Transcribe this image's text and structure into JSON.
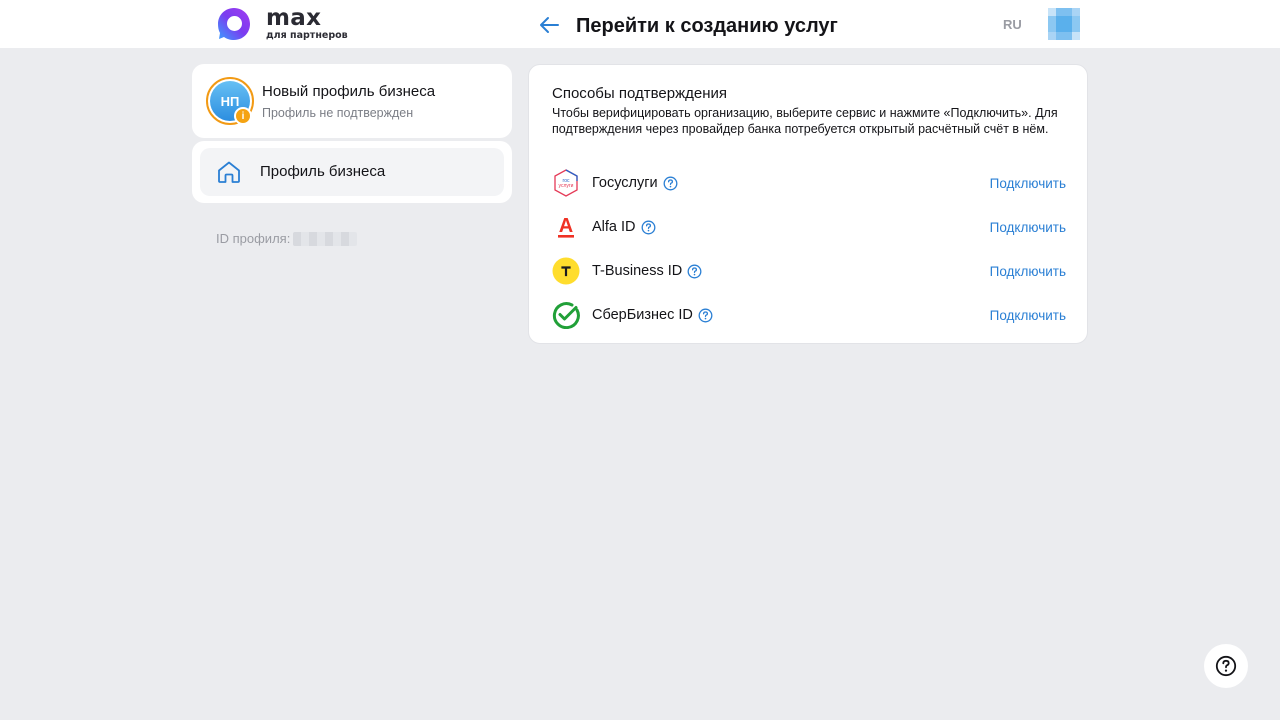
{
  "brand": {
    "name": "max",
    "subtitle": "для партнеров"
  },
  "header": {
    "title": "Перейти к созданию услуг",
    "lang": "RU"
  },
  "profile": {
    "initials": "НП",
    "badge": "i",
    "name": "Новый профиль бизнеса",
    "status": "Профиль не подтвержден",
    "id_label": "ID профиля:"
  },
  "sidebar": {
    "items": [
      {
        "label": "Профиль бизнеса",
        "icon": "home-icon"
      }
    ]
  },
  "verification": {
    "title": "Способы подтверждения",
    "description": "Чтобы верифицировать организацию, выберите сервис и нажмите «Подключить». Для подтверждения через провайдер банка потребуется открытый расчётный счёт в нём.",
    "providers": [
      {
        "name": "Госуслуги",
        "action": "Подключить",
        "icon": "gosuslugi-icon",
        "logo_text": "гос услуги"
      },
      {
        "name": "Alfa ID",
        "action": "Подключить",
        "icon": "alfa-icon",
        "logo_text": "A"
      },
      {
        "name": "T-Business ID",
        "action": "Подключить",
        "icon": "tbank-icon",
        "logo_text": "T"
      },
      {
        "name": "СберБизнес ID",
        "action": "Подключить",
        "icon": "sber-icon"
      }
    ]
  },
  "colors": {
    "accent": "#2a7fd4",
    "background": "#ebecef",
    "warning": "#f5a312",
    "alfa": "#ef3124",
    "tbank": "#ffdd2d",
    "sber": "#21a038"
  }
}
